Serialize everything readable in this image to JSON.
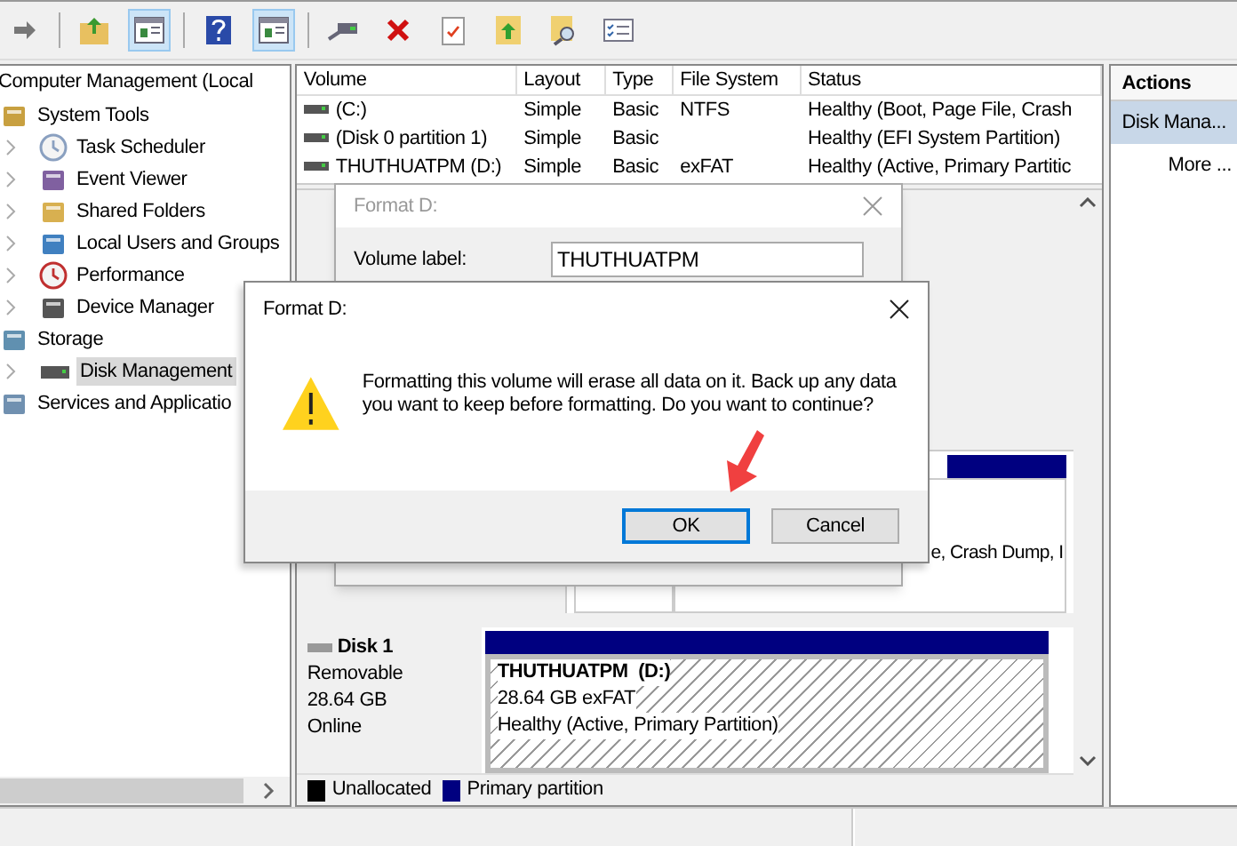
{
  "toolbar": {
    "buttons": [
      {
        "kind": "forward",
        "on": false
      },
      {
        "kind": "up",
        "on": false
      },
      {
        "kind": "tree",
        "on": true
      },
      {
        "kind": "help",
        "on": false
      },
      {
        "kind": "panel",
        "on": true
      },
      {
        "kind": "connect",
        "on": false
      },
      {
        "kind": "delete",
        "on": false
      },
      {
        "kind": "properties",
        "on": false
      },
      {
        "kind": "export",
        "on": false
      },
      {
        "kind": "find",
        "on": false
      },
      {
        "kind": "list",
        "on": false
      }
    ]
  },
  "tree": {
    "root": "Computer Management (Local",
    "items": [
      {
        "label": "System Tools",
        "selected": false,
        "children": [
          {
            "label": "Task Scheduler",
            "selected": false
          },
          {
            "label": "Event Viewer",
            "selected": false
          },
          {
            "label": "Shared Folders",
            "selected": false
          },
          {
            "label": "Local Users and Groups",
            "selected": false
          },
          {
            "label": "Performance",
            "selected": false
          },
          {
            "label": "Device Manager",
            "selected": false
          }
        ]
      },
      {
        "label": "Storage",
        "selected": false,
        "children": [
          {
            "label": "Disk Management",
            "selected": true
          }
        ]
      },
      {
        "label": "Services and Applicatio",
        "selected": false
      }
    ]
  },
  "volumes": {
    "columns": [
      "Volume",
      "Layout",
      "Type",
      "File System",
      "Status"
    ],
    "rows": [
      {
        "cells": [
          "(C:)",
          "Simple",
          "Basic",
          "NTFS",
          "Healthy (Boot, Page File, Crash"
        ]
      },
      {
        "cells": [
          "(Disk 0 partition 1)",
          "Simple",
          "Basic",
          "",
          "Healthy (EFI System Partition)"
        ]
      },
      {
        "cells": [
          "THUTHUATPM (D:)",
          "Simple",
          "Basic",
          "exFAT",
          "Healthy (Active, Primary Partitic"
        ]
      }
    ]
  },
  "disk0": {
    "partial_text": "e, Crash Dump, I"
  },
  "disk1": {
    "name": "Disk 1",
    "type": "Removable",
    "size": "28.64 GB",
    "status": "Online",
    "partition": {
      "name": "THUTHUATPM  (D:)",
      "detail": "28.64 GB exFAT",
      "status": "Healthy (Active, Primary Partition)"
    }
  },
  "legend": [
    {
      "label": "Unallocated",
      "color": "#000000"
    },
    {
      "label": "Primary partition",
      "color": "#000080"
    }
  ],
  "actions": {
    "title": "Actions",
    "items": [
      {
        "label": "Disk Mana...",
        "selected": true
      },
      {
        "label": "More ...",
        "selected": false
      }
    ]
  },
  "format_dialog": {
    "title": "Format D:",
    "field_label": "Volume label:",
    "field_value": "THUTHUATPM"
  },
  "confirm_dialog": {
    "title": "Format D:",
    "message": "Formatting this volume will erase all data on it. Back up any data you want to keep before formatting. Do you want to continue?",
    "buttons": [
      {
        "label": "OK",
        "default": true
      },
      {
        "label": "Cancel",
        "default": false
      }
    ]
  }
}
